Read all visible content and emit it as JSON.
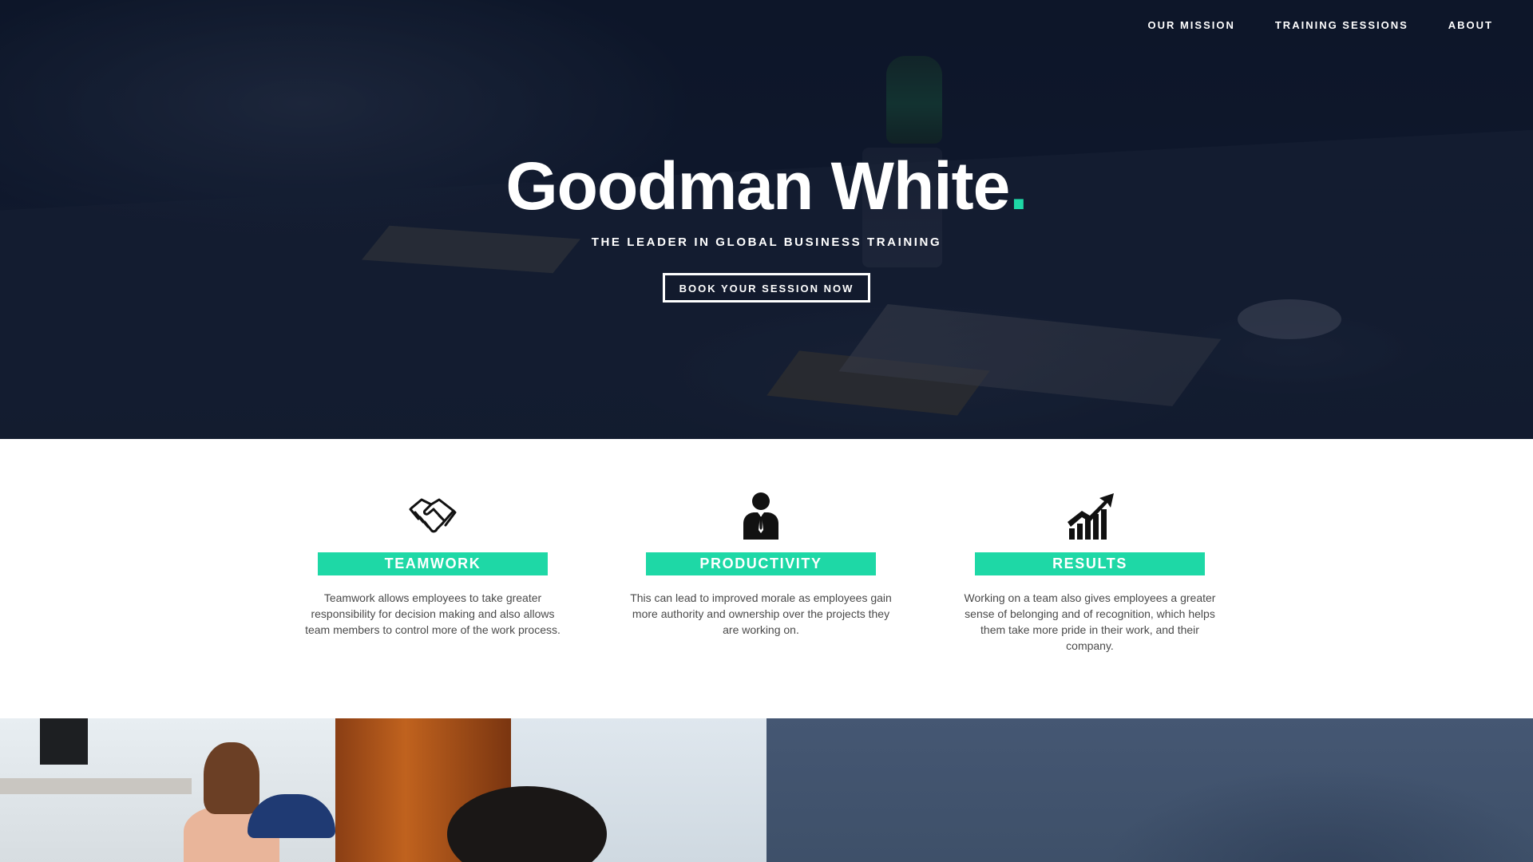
{
  "nav": {
    "items": [
      {
        "label": "OUR MISSION"
      },
      {
        "label": "TRAINING SESSIONS"
      },
      {
        "label": "ABOUT"
      }
    ]
  },
  "hero": {
    "title": "Goodman White",
    "title_dot": ".",
    "subtitle": "THE LEADER IN GLOBAL BUSINESS TRAINING",
    "cta_label": "BOOK YOUR SESSION NOW"
  },
  "features": [
    {
      "icon": "handshake-icon",
      "label": "TEAMWORK",
      "text": "Teamwork allows employees to take greater responsibility for decision making and also allows team members to control more of the work process."
    },
    {
      "icon": "businessman-icon",
      "label": "PRODUCTIVITY",
      "text": "This can lead to improved morale as employees gain more authority and ownership over the projects they are working on."
    },
    {
      "icon": "growth-chart-icon",
      "label": "RESULTS",
      "text": "Working on a team also gives employees a greater sense of belonging and of recognition, which helps them take more pride in their work, and their company."
    }
  ],
  "colors": {
    "accent": "#1ed8a6",
    "hero_background": "#0d1628",
    "text_body": "#4a4a4a",
    "bottom_right_panel": "#455773"
  }
}
